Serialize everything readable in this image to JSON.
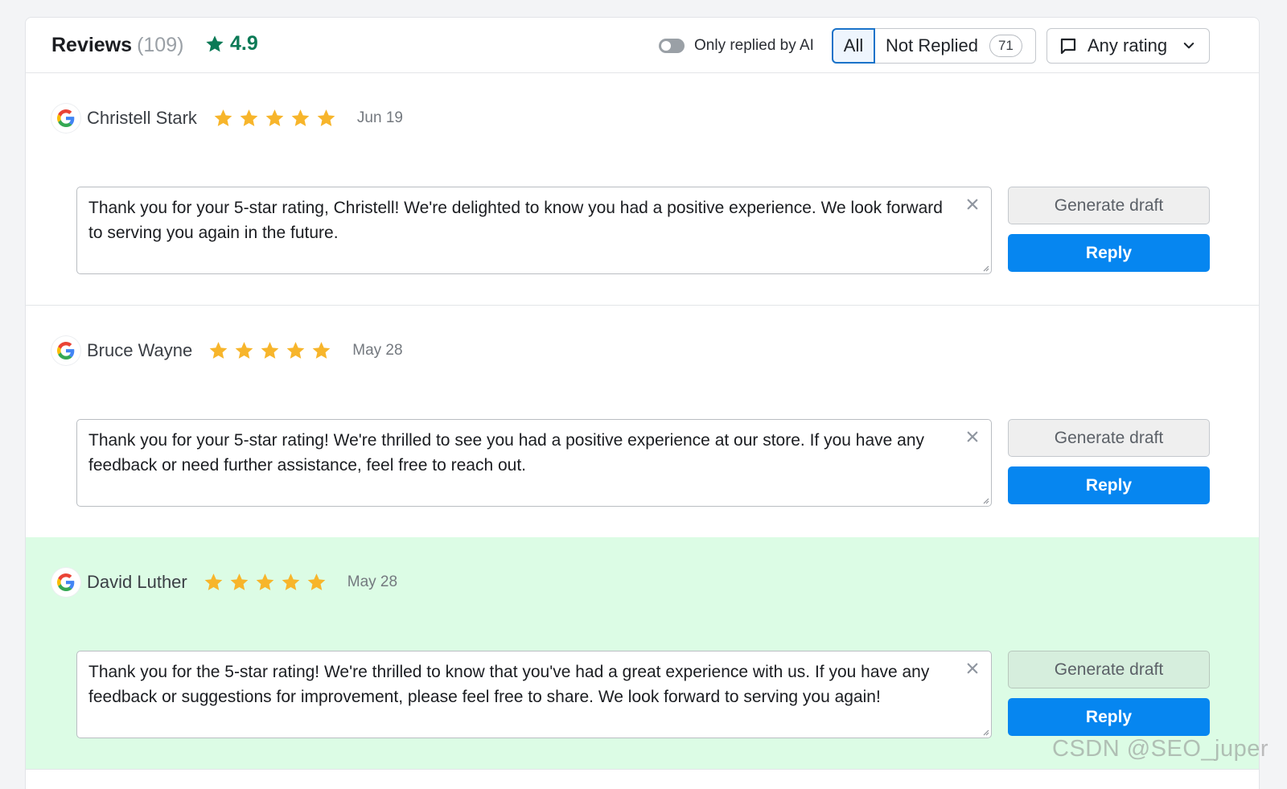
{
  "header": {
    "title": "Reviews",
    "count": "(109)",
    "average_rating": "4.9",
    "toggle_label": "Only replied by AI",
    "filter_all": "All",
    "filter_not_replied": "Not Replied",
    "not_replied_count": "71",
    "rating_select": "Any rating"
  },
  "reviews": [
    {
      "reviewer": "Christell Stark",
      "source": "Google",
      "stars": 5,
      "date": "Jun 19",
      "reply_text": "Thank you for your 5-star rating, Christell! We're delighted to know you had a positive experience. We look forward to serving you again in the future.",
      "generate_label": "Generate draft",
      "reply_label": "Reply"
    },
    {
      "reviewer": "Bruce Wayne",
      "source": "Google",
      "stars": 5,
      "date": "May 28",
      "reply_text": "Thank you for your 5-star rating! We're thrilled to see you had a positive experience at our store. If you have any feedback or need further assistance, feel free to reach out.",
      "generate_label": "Generate draft",
      "reply_label": "Reply"
    },
    {
      "reviewer": "David Luther",
      "source": "Google",
      "stars": 5,
      "date": "May 28",
      "reply_text": "Thank you for the 5-star rating! We're thrilled to know that you've had a great experience with us. If you have any feedback or suggestions for improvement, please feel free to share. We look forward to serving you again!",
      "generate_label": "Generate draft",
      "reply_label": "Reply"
    }
  ],
  "watermark": "CSDN @SEO_juper",
  "colors": {
    "accent_blue": "#0686f0",
    "rating_green": "#0b7a56",
    "star_gold": "#f7b52b",
    "highlight_row": "#dcfce5"
  }
}
